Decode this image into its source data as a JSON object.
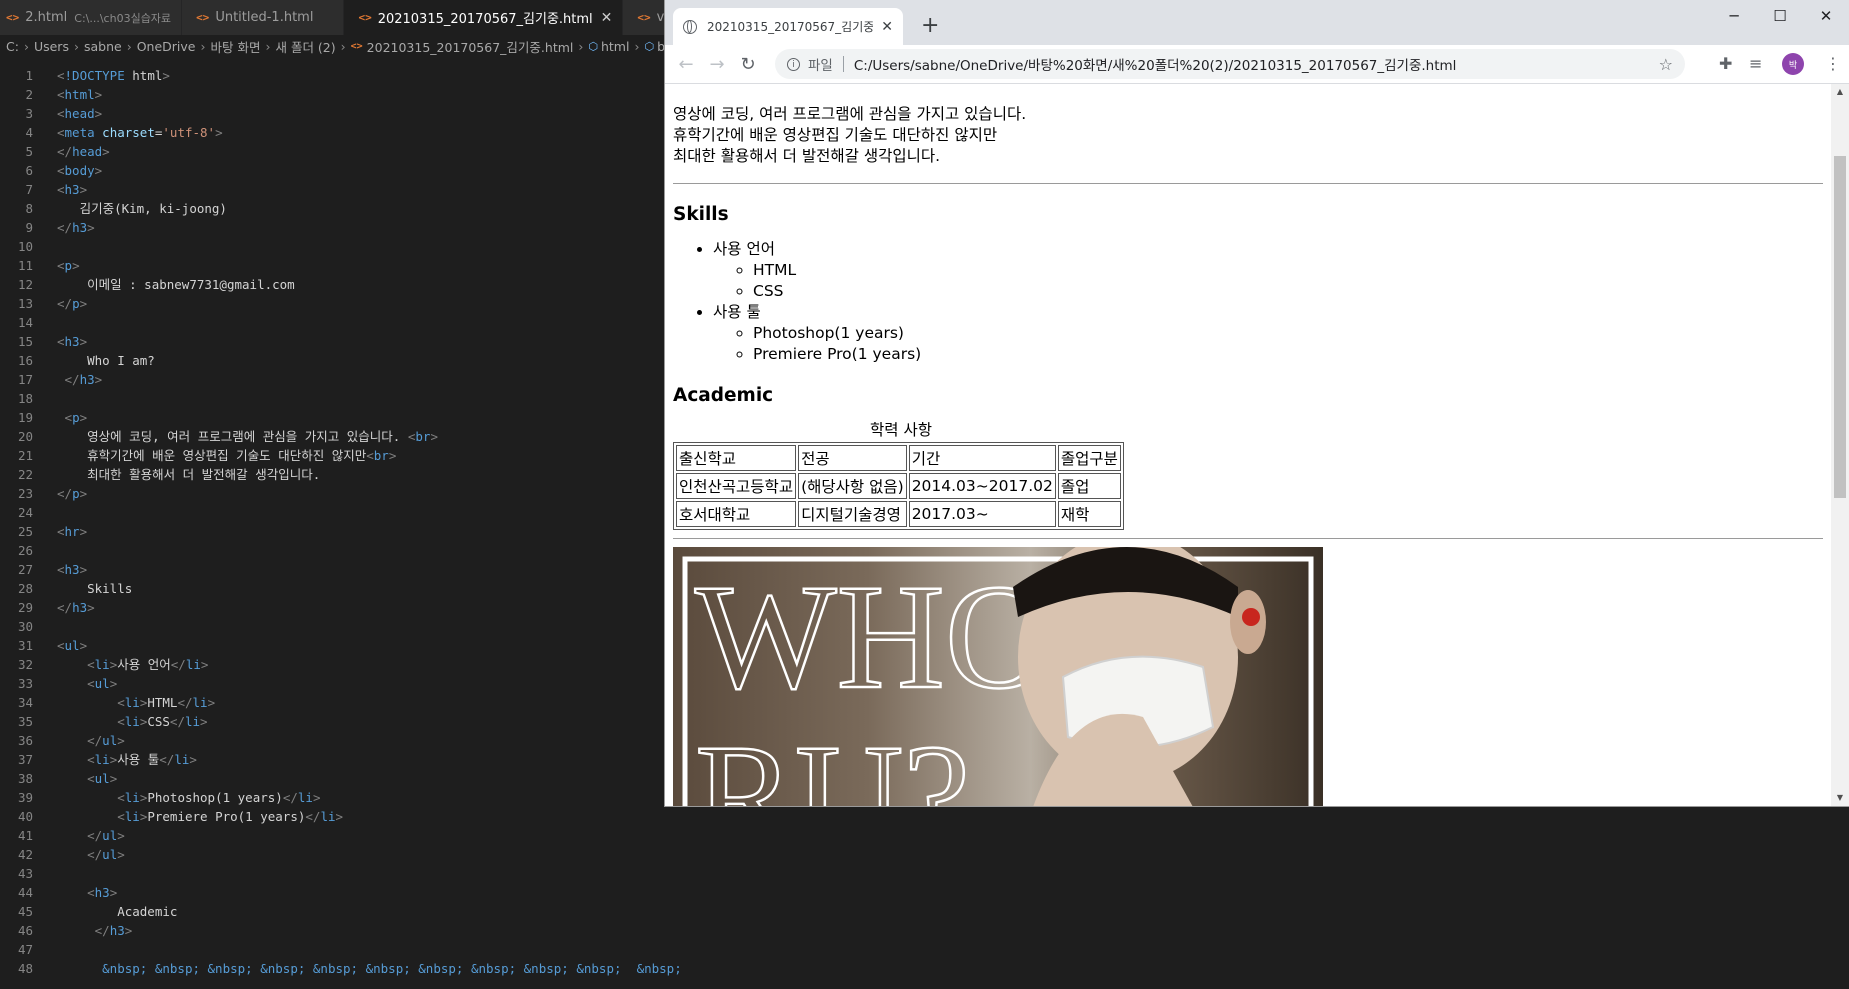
{
  "editor": {
    "tabs": [
      {
        "label": "2.html",
        "desc": "C:\\...\\ch03실습자료",
        "active": false
      },
      {
        "label": "Untitled-1.html",
        "desc": "",
        "active": false
      },
      {
        "label": "20210315_20170567_김기중.html",
        "desc": "",
        "active": true
      },
      {
        "label": "video.h",
        "desc": "",
        "active": false
      }
    ],
    "breadcrumb": [
      "C:",
      "Users",
      "sabne",
      "OneDrive",
      "바탕 화면",
      "새 폴더 (2)",
      "20210315_20170567_김기중.html",
      "html",
      "b"
    ],
    "lines": [
      "<!DOCTYPE html>",
      "<html>",
      "<head>",
      "<meta charset='utf-8'>",
      "</head>",
      "<body>",
      "<h3>",
      "   김기중(Kim, ki-joong)",
      "</h3>",
      "",
      "<p>",
      "    이메일 : sabnew7731@gmail.com",
      "</p>",
      "",
      "<h3>",
      "    Who I am?",
      " </h3>",
      "",
      " <p>",
      "    영상에 코딩, 여러 프로그램에 관심을 가지고 있습니다. <br>",
      "    휴학기간에 배운 영상편집 기술도 대단하진 않지만<br>",
      "    최대한 활용해서 더 발전해갈 생각입니다.",
      "</p>",
      "",
      "<hr>",
      "",
      "<h3>",
      "    Skills",
      "</h3>",
      "",
      "<ul>",
      "    <li>사용 언어</li>",
      "    <ul>",
      "        <li>HTML</li>",
      "        <li>CSS</li>",
      "    </ul>",
      "    <li>사용 툴</li>",
      "    <ul>",
      "        <li>Photoshop(1 years)</li>",
      "        <li>Premiere Pro(1 years)</li>",
      "    </ul>",
      "    </ul>",
      "",
      "    <h3>",
      "        Academic",
      "     </h3>",
      "",
      "      &nbsp; &nbsp; &nbsp; &nbsp; &nbsp; &nbsp; &nbsp; &nbsp; &nbsp; &nbsp;  &nbsp; &nbsp; &nbsp; &nbsp; &nbsp; &nbsp; 학력 사항"
    ]
  },
  "browser": {
    "tab_title": "20210315_20170567_김기중.html",
    "window_controls": {
      "minimize": "─",
      "maximize": "☐",
      "close": "✕"
    },
    "address": {
      "scheme_label": "파일",
      "url": "C:/Users/sabne/OneDrive/바탕%20화면/새%20폴더%20(2)/20210315_20170567_김기중.html"
    },
    "avatar_text": "박",
    "page": {
      "intro_lines": [
        "영상에 코딩, 여러 프로그램에 관심을 가지고 있습니다.",
        "휴학기간에 배운 영상편집 기술도 대단하진 않지만",
        "최대한 활용해서 더 발전해갈 생각입니다."
      ],
      "skills_heading": "Skills",
      "skills": [
        {
          "label": "사용 언어",
          "items": [
            "HTML",
            "CSS"
          ]
        },
        {
          "label": "사용 툴",
          "items": [
            "Photoshop(1 years)",
            "Premiere Pro(1 years)"
          ]
        }
      ],
      "academic_heading": "Academic",
      "table_caption": "학력 사항",
      "table_rows": [
        [
          "출신학교",
          "전공",
          "기간",
          "졸업구분"
        ],
        [
          "인천산곡고등학교",
          "(해당사항 없음)",
          "2014.03~2017.02",
          "졸업"
        ],
        [
          "호서대학교",
          "디지털기술경영",
          "2017.03~",
          "재학"
        ]
      ],
      "photo_text": [
        "WHO",
        "RU?"
      ]
    }
  }
}
